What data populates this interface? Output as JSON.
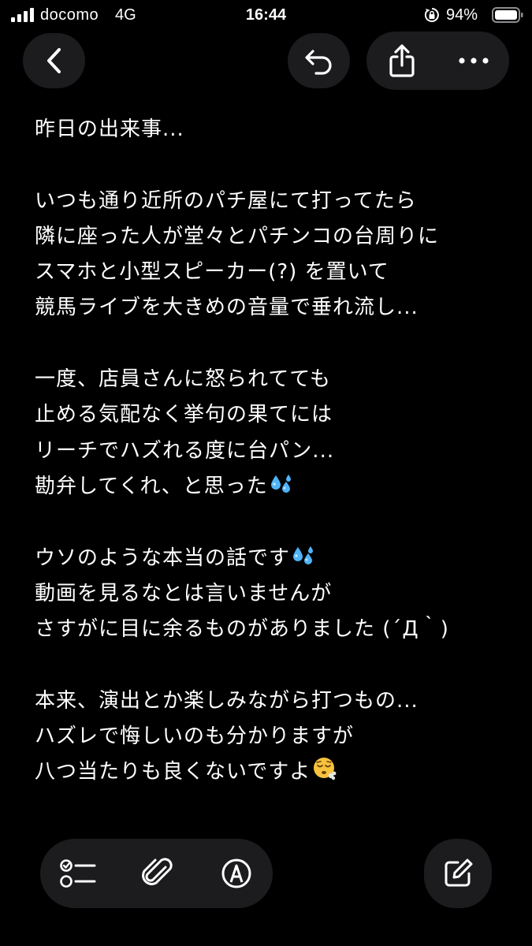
{
  "status_bar": {
    "carrier": "docomo",
    "network": "4G",
    "time": "16:44",
    "battery_percent": "94%",
    "signal_icon": "signal-bars-icon",
    "rotation_lock_icon": "rotation-lock-icon",
    "battery_icon": "battery-icon"
  },
  "nav": {
    "back_icon": "chevron-left-icon",
    "undo_icon": "undo-icon",
    "share_icon": "share-icon",
    "more_icon": "ellipsis-icon"
  },
  "note": {
    "lines": [
      "昨日の出来事...",
      "",
      "いつも通り近所のパチ屋にて打ってたら",
      "隣に座った人が堂々とパチンコの台周りに",
      "スマホと小型スピーカー(?) を置いて",
      "競馬ライブを大きめの音量で垂れ流し...",
      "",
      "一度、店員さんに怒られてても",
      "止める気配なく挙句の果てには",
      "リーチでハズれる度に台パン...",
      "勘弁してくれ、と思った",
      "",
      "ウソのような本当の話です",
      "動画を見るなとは言いませんが",
      "さすがに目に余るものがありました (´Д｀)",
      "",
      "本来、演出とか楽しみながら打つもの...",
      "ハズレで悔しいのも分かりますが",
      "八つ当たりも良くないですよ"
    ],
    "emoji_sweat": "sweat-droplets-icon",
    "emoji_face": "exhaling-face-icon"
  },
  "toolbar": {
    "checklist_icon": "checklist-icon",
    "attach_icon": "paperclip-icon",
    "markup_icon": "markup-pen-icon",
    "compose_icon": "compose-icon"
  },
  "colors": {
    "background": "#000000",
    "button_bg": "#1c1c1e",
    "text": "#ffffff",
    "emoji_blue": "#4fb3f6",
    "emoji_yellow": "#f7c33c"
  }
}
